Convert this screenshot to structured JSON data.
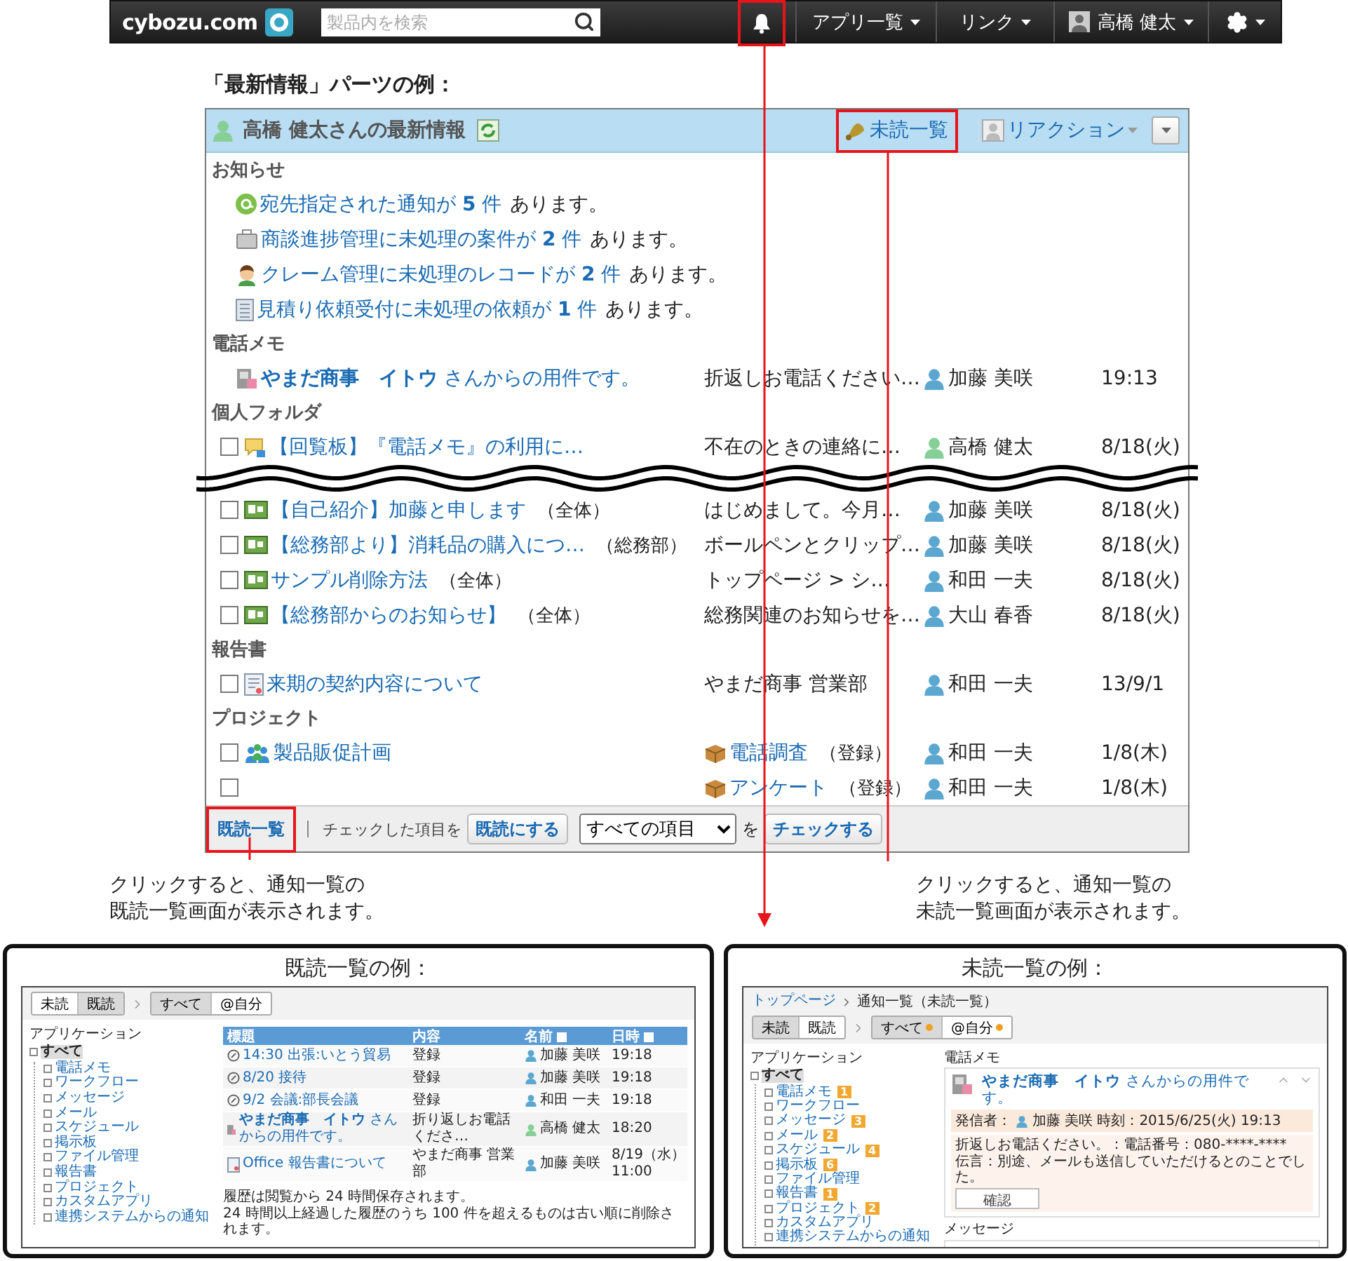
{
  "top_bar": {
    "logo": "cybozu.com",
    "search": {
      "placeholder": "製品内を検索"
    },
    "notifications": {
      "highlighted": true
    },
    "menus": [
      {
        "kind": "text",
        "label": "アプリ一覧"
      },
      {
        "kind": "text",
        "label": "リンク"
      },
      {
        "kind": "user",
        "label": "高橋 健太"
      },
      {
        "kind": "settings"
      }
    ]
  },
  "example_heading": "「最新情報」パーツの例：",
  "panel": {
    "title": "高橋 健太さんの最新情報",
    "unread_link": {
      "label": "未読一覧",
      "highlighted": true
    },
    "reaction_menu": {
      "label": "リアクション"
    },
    "sections": [
      {
        "kind": "notices",
        "title": "お知らせ",
        "items": [
          {
            "kind": "mention",
            "link": "宛先指定された通知が **5** 件",
            "text": "あります。"
          },
          {
            "kind": "deal",
            "link": "商談進捗管理に未処理の案件が **2** 件",
            "text": "あります。"
          },
          {
            "kind": "claim",
            "link": "クレーム管理に未処理のレコードが **2** 件",
            "text": "あります。"
          },
          {
            "kind": "estimate",
            "link": "見積り依頼受付に未処理の依頼が **1** 件",
            "text": "あります。"
          }
        ]
      },
      {
        "kind": "list",
        "title": "電話メモ",
        "rows": [
          {
            "kind": "memo",
            "title": "**やまだ商事　イトウ** さんからの用件です。",
            "content": "折返しお電話ください…",
            "sender": "加藤 美咲",
            "color": "#5ba7d0",
            "date": "19:13"
          }
        ]
      },
      {
        "kind": "list",
        "title": "個人フォルダ",
        "rows": [
          {
            "kind": "message",
            "checked": false,
            "title": "【回覧板】『電話メモ』の利用に…",
            "content": "不在のときの連絡に…",
            "sender": "高橋 健太",
            "color": "#86cf96",
            "date": "8/18(火)"
          },
          {
            "kind": "break"
          },
          {
            "kind": "bulletin",
            "checked": false,
            "title": "【自己紹介】加藤と申します",
            "scope": "（全体）",
            "content": "はじめまして。今月…",
            "sender": "加藤 美咲",
            "color": "#5ba7d0",
            "date": "8/18(火)"
          },
          {
            "kind": "bulletin",
            "checked": false,
            "title": "【総務部より】消耗品の購入につ…",
            "scope": "（総務部）",
            "content": "ボールペンとクリップ…",
            "sender": "加藤 美咲",
            "color": "#5ba7d0",
            "date": "8/18(火)"
          },
          {
            "kind": "bulletin",
            "checked": false,
            "title": "サンプル削除方法",
            "scope": "（全体）",
            "content": "トップページ > シ…",
            "sender": "和田 一夫",
            "color": "#5ba7d0",
            "date": "8/18(火)"
          },
          {
            "kind": "bulletin",
            "checked": false,
            "title": "【総務部からのお知らせ】",
            "scope": "（全体）",
            "content": "総務関連のお知らせを…",
            "sender": "大山 春香",
            "color": "#5ba7d0",
            "date": "8/18(火)"
          }
        ]
      },
      {
        "kind": "list",
        "title": "報告書",
        "rows": [
          {
            "kind": "report",
            "checked": false,
            "title": "来期の契約内容について",
            "content": "やまだ商事 営業部",
            "sender": "和田 一夫",
            "color": "#5ba7d0",
            "date": "13/9/1"
          }
        ]
      },
      {
        "kind": "list",
        "title": "プロジェクト",
        "rows": [
          {
            "kind": "project",
            "checked": false,
            "title": "製品販促計画",
            "content_link": "電話調査",
            "content_note": "（登録）",
            "sender": "和田 一夫",
            "color": "#5ba7d0",
            "date": "1/8(木)"
          },
          {
            "kind": "blank",
            "checked": false,
            "content_link": "アンケート",
            "content_note": "（登録）",
            "sender": "和田 一夫",
            "color": "#5ba7d0",
            "date": "1/8(木)"
          }
        ]
      }
    ],
    "footer": {
      "read_list_button": {
        "label": "既読一覧",
        "highlighted": true
      },
      "label": "チェックした項目を",
      "mark_read_button": "既読にする",
      "select": {
        "value": "すべての項目"
      },
      "particle": "を",
      "check_button": "チェックする"
    }
  },
  "callouts": [
    {
      "lines": [
        "クリックすると、通知一覧の",
        "既読一覧画面が表示されます。"
      ]
    },
    {
      "lines": [
        "クリックすると、通知一覧の",
        "未読一覧画面が表示されます。"
      ]
    }
  ],
  "read_example": {
    "title": "既読一覧の例：",
    "read_tabs": [
      {
        "label": "未読",
        "selected": false
      },
      {
        "label": "既読",
        "selected": true
      }
    ],
    "scope_tabs": [
      {
        "label": "すべて",
        "selected": true
      },
      {
        "label": "@自分",
        "selected": false
      }
    ],
    "tree": {
      "label": "アプリケーション",
      "root": {
        "label": "すべて",
        "selected": true,
        "children": [
          {
            "label": "電話メモ"
          },
          {
            "label": "ワークフロー"
          },
          {
            "label": "メッセージ"
          },
          {
            "label": "メール"
          },
          {
            "label": "スケジュール"
          },
          {
            "label": "掲示板"
          },
          {
            "label": "ファイル管理"
          },
          {
            "label": "報告書"
          },
          {
            "label": "プロジェクト"
          },
          {
            "label": "カスタムアプリ"
          },
          {
            "label": "連携システムからの通知"
          }
        ]
      }
    },
    "columns": [
      "標題",
      "内容",
      "名前",
      "日時"
    ],
    "rows": [
      {
        "kind": "schedule",
        "title": "14:30 出張:いとう貿易",
        "content": "登録",
        "sender": "加藤 美咲",
        "color": "#5ba7d0",
        "time": "19:18"
      },
      {
        "kind": "schedule",
        "title": "8/20 接待",
        "content": "登録",
        "sender": "加藤 美咲",
        "color": "#5ba7d0",
        "time": "19:18"
      },
      {
        "kind": "schedule",
        "title": "9/2 会議:部長会議",
        "content": "登録",
        "sender": "和田 一夫",
        "color": "#5ba7d0",
        "time": "19:18"
      },
      {
        "kind": "memo",
        "title": "**やまだ商事　イトウ** さんからの用件です。",
        "content": "折り返しお電話くださ…",
        "sender": "高橋 健太",
        "color": "#86cf96",
        "time": "18:20"
      },
      {
        "kind": "report",
        "title": "Office 報告書について",
        "content": "やまだ商事 営業部",
        "sender": "加藤 美咲",
        "color": "#5ba7d0",
        "time": "8/19（水） 11:00"
      }
    ],
    "notes": [
      "履歴は閲覧から 24 時間保存されます。",
      "24 時間以上経過した履歴のうち 100 件を超えるものは古い順に削除されます。"
    ]
  },
  "unread_example": {
    "title": "未読一覧の例：",
    "breadcrumb": [
      "トップページ",
      "通知一覧（未読一覧）"
    ],
    "read_tabs": [
      {
        "label": "未読",
        "selected": true
      },
      {
        "label": "既読",
        "selected": false
      }
    ],
    "scope_tabs": [
      {
        "label": "すべて",
        "selected": true,
        "dot": true
      },
      {
        "label": "@自分",
        "selected": false,
        "dot": true
      }
    ],
    "tree": {
      "label": "アプリケーション",
      "root": {
        "label": "すべて",
        "selected": true,
        "children": [
          {
            "label": "電話メモ",
            "count": "1"
          },
          {
            "label": "ワークフロー"
          },
          {
            "label": "メッセージ",
            "count": "3"
          },
          {
            "label": "メール",
            "count": "2"
          },
          {
            "label": "スケジュール",
            "count": "4"
          },
          {
            "label": "掲示板",
            "count": "6"
          },
          {
            "label": "ファイル管理"
          },
          {
            "label": "報告書",
            "count": "1"
          },
          {
            "label": "プロジェクト",
            "count": "2"
          },
          {
            "label": "カスタムアプリ"
          },
          {
            "label": "連携システムからの通知"
          }
        ]
      }
    },
    "section": "電話メモ",
    "card": {
      "title": "**やまだ商事　イトウ** さんからの用件です。",
      "sender_label": "発信者：",
      "sender": "加藤 美咲",
      "color": "#5ba7d0",
      "time": "時刻：2015/6/25(火) 19:13",
      "lines": [
        "折返しお電話ください。：電話番号：080-****-****",
        "伝言：別途、メールも送信していただけるとのことでした。"
      ],
      "button": "確認"
    },
    "next_section": "メッセージ"
  }
}
